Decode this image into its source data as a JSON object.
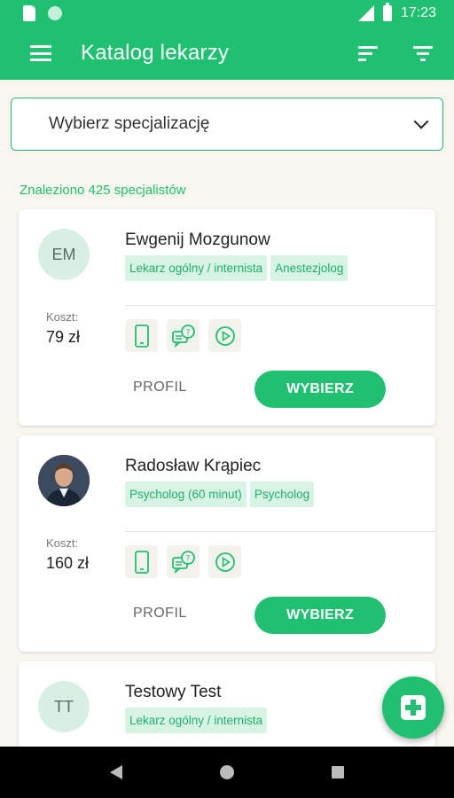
{
  "status_bar": {
    "time": "17:23"
  },
  "app_bar": {
    "title": "Katalog lekarzy",
    "icons": [
      "menu-icon",
      "sort-icon",
      "filter-icon"
    ]
  },
  "specialization_select": {
    "placeholder": "Wybierz specjalizację"
  },
  "results": {
    "found_text": "Znaleziono 425 specjalistów"
  },
  "doctors": [
    {
      "initials": "EM",
      "name": "Ewgenij Mozgunow",
      "tags": [
        "Lekarz ogólny / internista",
        "Anestezjolog"
      ],
      "cost_label": "Koszt:",
      "cost": "79 zł",
      "profile_label": "PROFIL",
      "choose_label": "WYBIERZ"
    },
    {
      "initials": "",
      "name": "Radosław Krąpiec",
      "tags": [
        "Psycholog (60 minut)",
        "Psycholog"
      ],
      "cost_label": "Koszt:",
      "cost": "160 zł",
      "profile_label": "PROFIL",
      "choose_label": "WYBIERZ"
    },
    {
      "initials": "TT",
      "name": "Testowy Test",
      "tags": [
        "Lekarz ogólny / internista"
      ]
    }
  ],
  "consultation_modes": [
    "phone-icon",
    "chat-icon",
    "video-icon"
  ],
  "colors": {
    "accent": "#1fc06f",
    "tag_bg": "#d7f3e3",
    "background": "#f8f6ee"
  }
}
